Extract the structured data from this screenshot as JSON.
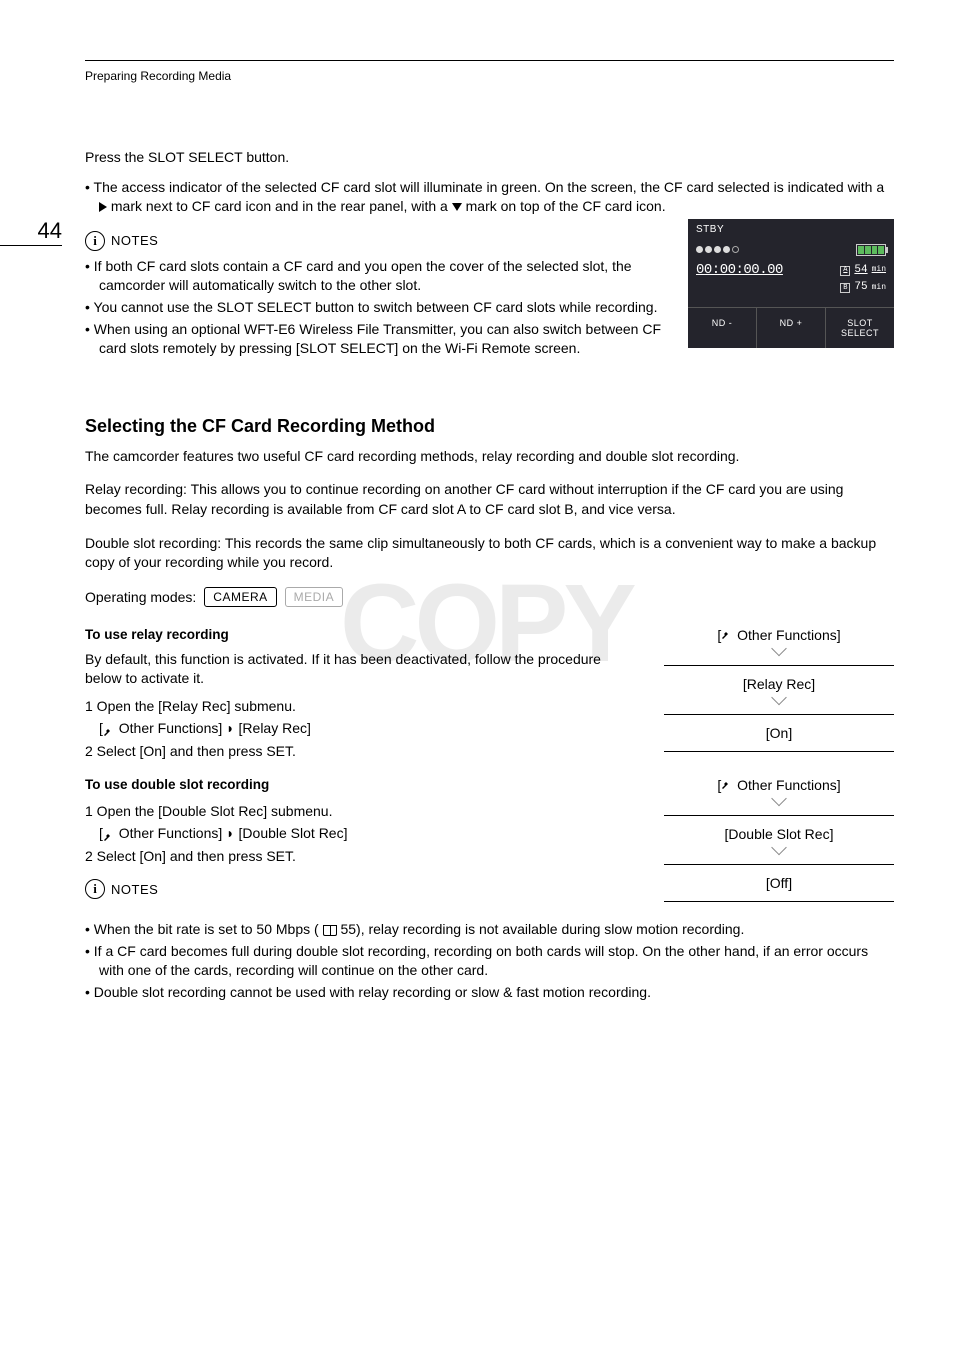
{
  "breadcrumb": "Preparing Recording Media",
  "page_number": "44",
  "intro": {
    "line1": "Press the SLOT SELECT button.",
    "bullet1_a": "The access indicator of the selected CF card slot will illuminate in green. On the screen, the CF card selected is indicated with a ",
    "bullet1_b": " mark next to CF card icon and in the rear panel, with a ",
    "bullet1_c": " mark on top of the CF card icon."
  },
  "notes1": {
    "label": "NOTES",
    "bullet1": "If both CF card slots contain a CF card and you open the cover of the selected slot, the camcorder will automatically switch to the other slot.",
    "bullet2": "You cannot use the SLOT SELECT button to switch between CF card slots while recording.",
    "bullet3": "When using an optional WFT-E6 Wireless File Transmitter, you can also switch between CF card slots remotely by pressing [SLOT SELECT] on the Wi-Fi Remote screen."
  },
  "screen": {
    "stby": "STBY",
    "timecode": "00:00:00.00",
    "cardA_label": "A",
    "cardA_time": "54",
    "cardB_label": "B",
    "cardB_time": "75",
    "min": "min",
    "btn1": "ND -",
    "btn2": "ND +",
    "btn3": "SLOT SELECT"
  },
  "section2": {
    "heading": "Selecting the CF Card Recording Method",
    "para1": "The camcorder features two useful CF card recording methods, relay recording and double slot recording.",
    "para2": "Relay recording: This allows you to continue recording on another CF card without interruption if the CF card you are using becomes full. Relay recording is available from CF card slot A to CF card slot B, and vice versa.",
    "para3": "Double slot recording: This records the same clip simultaneously to both CF cards, which is a convenient way to make a backup copy of your recording while you record.",
    "operating_modes_label": "Operating modes:",
    "mode_camera": "CAMERA",
    "mode_media": "MEDIA"
  },
  "relay": {
    "heading": "To use relay recording",
    "desc": "By default, this function is activated. If it has been deactivated, follow the procedure below to activate it.",
    "step1": "1 Open the [Relay Rec] submenu.",
    "path_a": "Other Functions]",
    "path_b": "[Relay Rec]",
    "step2": "2 Select [On] and then press SET.",
    "menu1": "Other Functions]",
    "menu2": "[Relay Rec]",
    "menu3": "[On]"
  },
  "double": {
    "heading": "To use double slot recording",
    "step1": "1 Open the [Double Slot Rec] submenu.",
    "path_a": "Other Functions]",
    "path_b": "[Double Slot Rec]",
    "step2": "2 Select [On] and then press SET.",
    "menu1": "Other Functions]",
    "menu2": "[Double Slot Rec]",
    "menu3": "[Off]"
  },
  "notes2": {
    "label": "NOTES",
    "bullet1_a": "When the bit rate is set to 50 Mbps (",
    "bullet1_b": " 55), relay recording is not available during slow motion recording.",
    "bullet2": "If a CF card becomes full during double slot recording, recording on both cards will stop. On the other hand, if an error occurs with one of the cards, recording will continue on the other card.",
    "bullet3": "Double slot recording cannot be used with relay recording or slow & fast motion recording."
  },
  "watermark": "COPY"
}
